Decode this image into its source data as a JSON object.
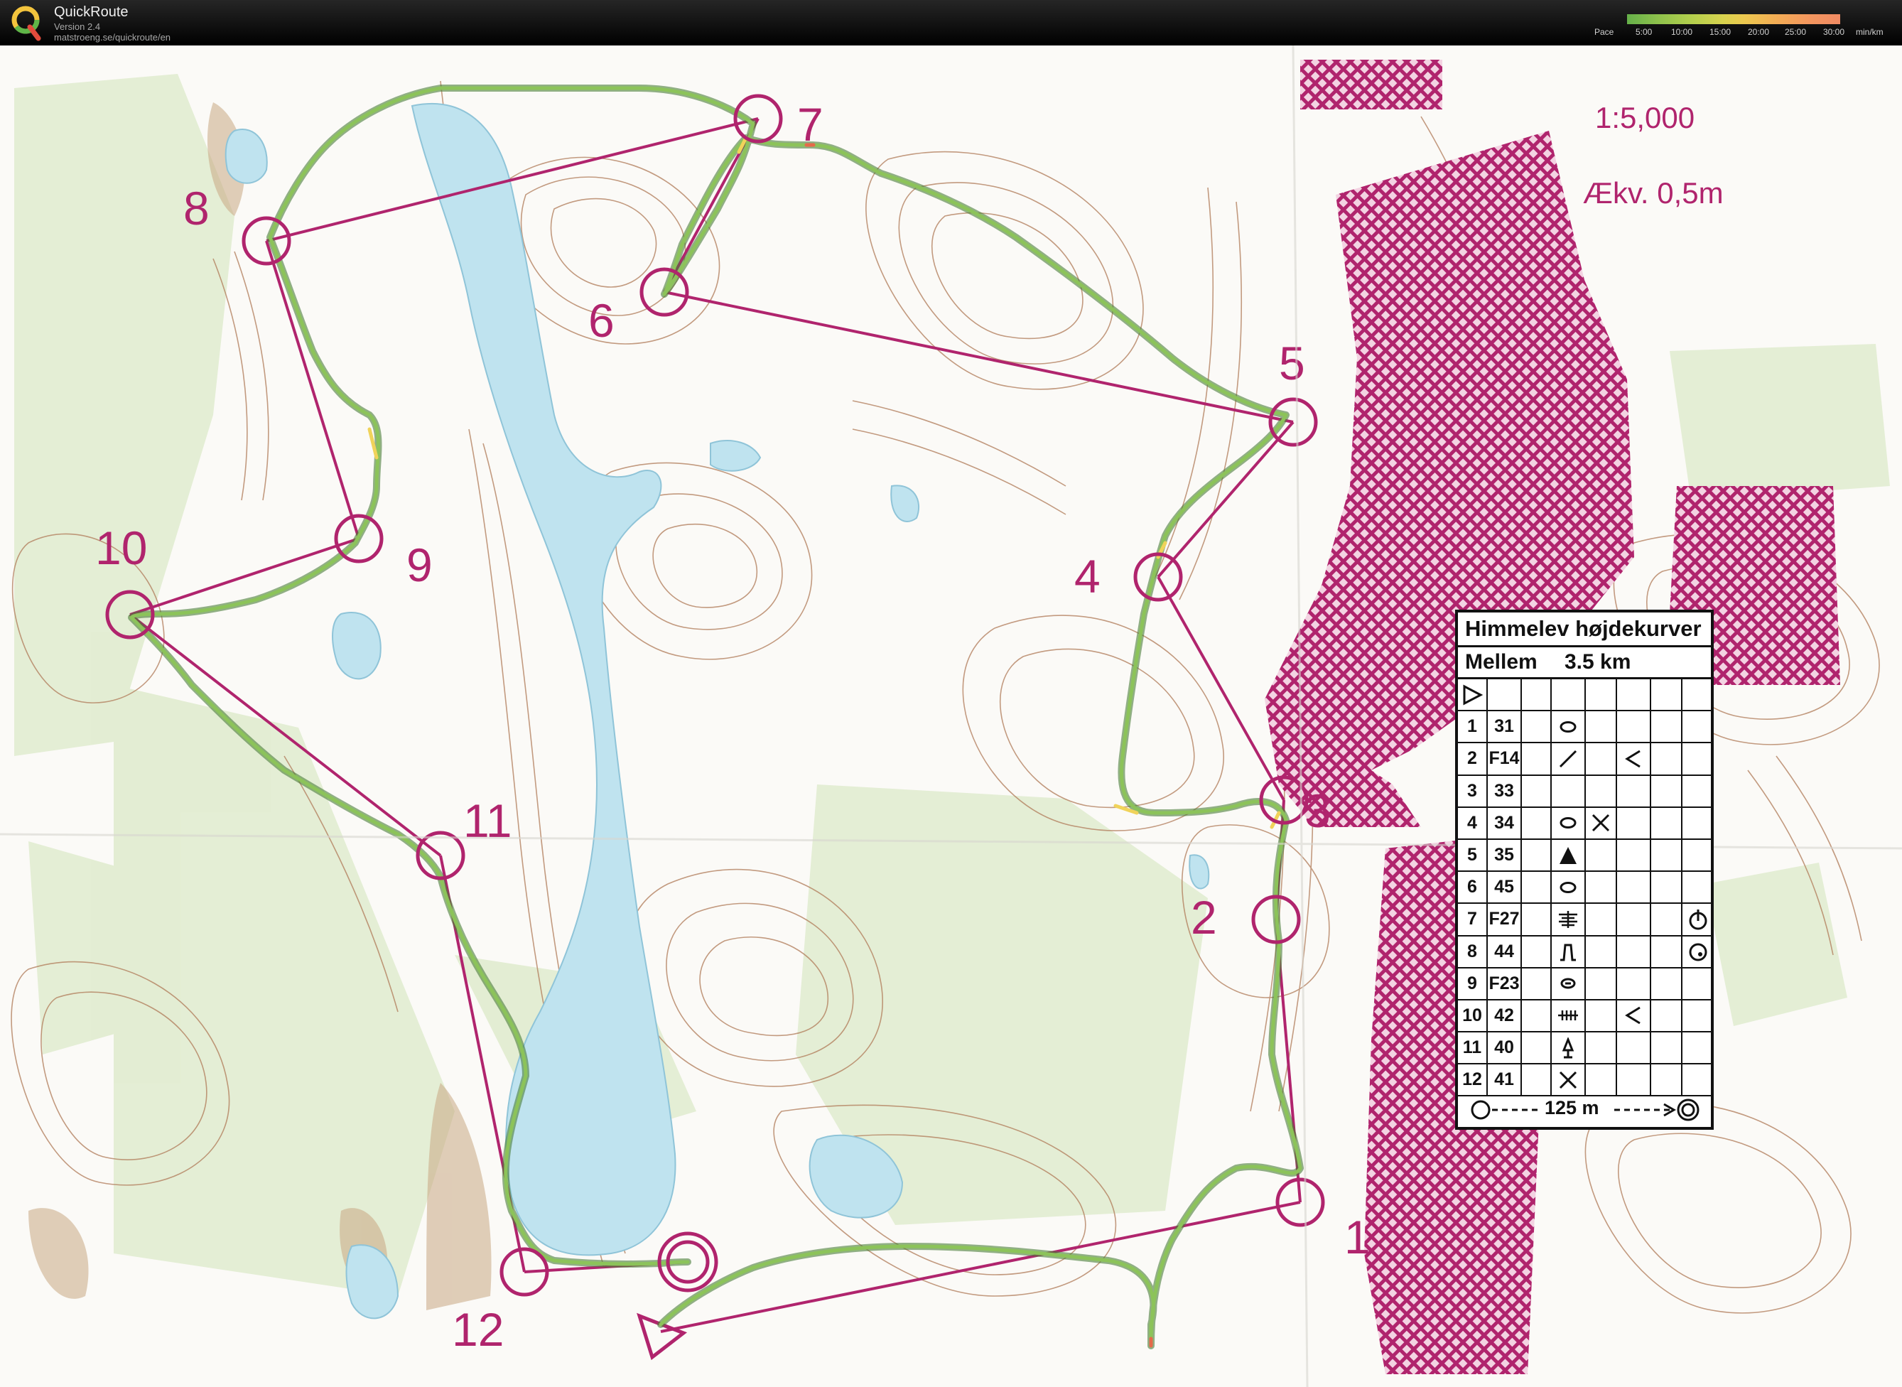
{
  "app": {
    "title": "QuickRoute",
    "version": "Version 2.4",
    "url": "matstroeng.se/quickroute/en"
  },
  "pace_legend": {
    "label": "Pace",
    "ticks": [
      "5:00",
      "10:00",
      "15:00",
      "20:00",
      "25:00",
      "30:00",
      "min/km"
    ]
  },
  "map": {
    "scale": "1:5,000",
    "contour_interval": "Ækv. 0,5m",
    "control_numbers": [
      "1",
      "2",
      "3",
      "4",
      "5",
      "6",
      "7",
      "8",
      "9",
      "10",
      "11",
      "12"
    ],
    "colors": {
      "course": "#b0246d",
      "route": "#6aa84f",
      "water": "#bfe3ef",
      "vegetation": "#e1ecd0",
      "contour": "#b07a58",
      "out_of_bounds": "#b0246d"
    }
  },
  "control_description": {
    "title": "Himmelev højdekurver",
    "course": "Mellem",
    "length": "3.5 km",
    "start_symbol": "start-triangle",
    "rows": [
      {
        "num": "1",
        "code": "31",
        "feature": "knoll-icon",
        "extra": "",
        "appearance": ""
      },
      {
        "num": "2",
        "code": "F14",
        "feature": "ditch-icon",
        "extra": "angle-icon",
        "appearance": ""
      },
      {
        "num": "3",
        "code": "33",
        "feature": "",
        "extra": "",
        "appearance": ""
      },
      {
        "num": "4",
        "code": "34",
        "feature": "knoll-icon",
        "extra": "cross-icon",
        "appearance": ""
      },
      {
        "num": "5",
        "code": "35",
        "feature": "triangle-icon",
        "extra": "",
        "appearance": ""
      },
      {
        "num": "6",
        "code": "45",
        "feature": "knoll-icon",
        "extra": "",
        "appearance": ""
      },
      {
        "num": "7",
        "code": "F27",
        "feature": "marsh-icon",
        "extra": "",
        "appearance": "clock-icon"
      },
      {
        "num": "8",
        "code": "44",
        "feature": "spur-icon",
        "extra": "",
        "appearance": "target-icon"
      },
      {
        "num": "9",
        "code": "F23",
        "feature": "small-knoll-icon",
        "extra": "",
        "appearance": ""
      },
      {
        "num": "10",
        "code": "42",
        "feature": "fence-icon",
        "extra": "angle-icon",
        "appearance": ""
      },
      {
        "num": "11",
        "code": "40",
        "feature": "tower-icon",
        "extra": "",
        "appearance": ""
      },
      {
        "num": "12",
        "code": "41",
        "feature": "cross-icon",
        "extra": "",
        "appearance": ""
      }
    ],
    "finish_line": "125 m"
  }
}
